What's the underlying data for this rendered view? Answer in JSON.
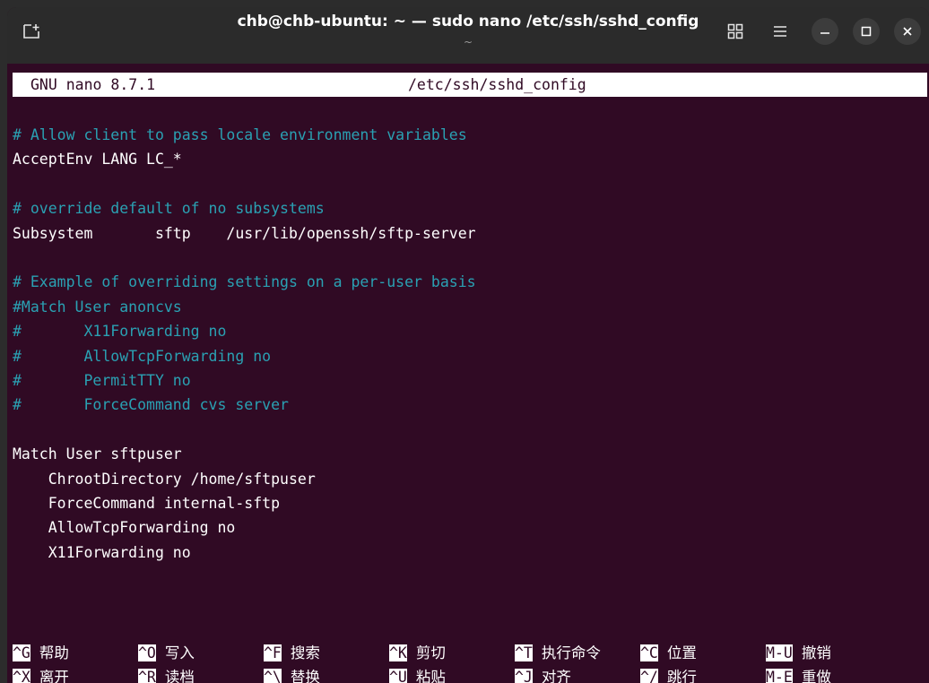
{
  "window": {
    "title": "chb@chb-ubuntu: ~ — sudo nano /etc/ssh/sshd_config",
    "subtitle": "~"
  },
  "titlebar_icons": {
    "new_tab": "new-tab-icon",
    "grid": "grid-view-icon",
    "menu": "hamburger-menu-icon",
    "minimize": "minimize-icon",
    "maximize": "maximize-icon",
    "close": "close-icon"
  },
  "nano": {
    "version": "GNU nano 8.7.1",
    "filename": "/etc/ssh/sshd_config"
  },
  "file_lines": [
    {
      "text": "# Allow client to pass locale environment variables",
      "type": "comment"
    },
    {
      "text": "AcceptEnv LANG LC_*",
      "type": "code"
    },
    {
      "text": "",
      "type": "blank"
    },
    {
      "text": "# override default of no subsystems",
      "type": "comment"
    },
    {
      "text": "Subsystem       sftp    /usr/lib/openssh/sftp-server",
      "type": "code"
    },
    {
      "text": "",
      "type": "blank"
    },
    {
      "text": "# Example of overriding settings on a per-user basis",
      "type": "comment"
    },
    {
      "text": "#Match User anoncvs",
      "type": "comment"
    },
    {
      "text": "#       X11Forwarding no",
      "type": "comment"
    },
    {
      "text": "#       AllowTcpForwarding no",
      "type": "comment"
    },
    {
      "text": "#       PermitTTY no",
      "type": "comment"
    },
    {
      "text": "#       ForceCommand cvs server",
      "type": "comment"
    },
    {
      "text": "",
      "type": "blank"
    },
    {
      "text": "Match User sftpuser",
      "type": "code"
    },
    {
      "text": "    ChrootDirectory /home/sftpuser",
      "type": "code"
    },
    {
      "text": "    ForceCommand internal-sftp",
      "type": "code"
    },
    {
      "text": "    AllowTcpForwarding no",
      "type": "code"
    },
    {
      "text": "    X11Forwarding no",
      "type": "code"
    }
  ],
  "shortcuts_row1": [
    {
      "key": "^G",
      "label": "帮助"
    },
    {
      "key": "^O",
      "label": "写入"
    },
    {
      "key": "^F",
      "label": "搜索"
    },
    {
      "key": "^K",
      "label": "剪切"
    },
    {
      "key": "^T",
      "label": "执行命令"
    },
    {
      "key": "^C",
      "label": "位置"
    },
    {
      "key": "M-U",
      "label": "撤销"
    }
  ],
  "shortcuts_row2": [
    {
      "key": "^X",
      "label": "离开"
    },
    {
      "key": "^R",
      "label": "读档"
    },
    {
      "key": "^\\",
      "label": "替换"
    },
    {
      "key": "^U",
      "label": "粘贴"
    },
    {
      "key": "^J",
      "label": "对齐"
    },
    {
      "key": "^/",
      "label": "跳行"
    },
    {
      "key": "M-E",
      "label": "重做"
    }
  ]
}
